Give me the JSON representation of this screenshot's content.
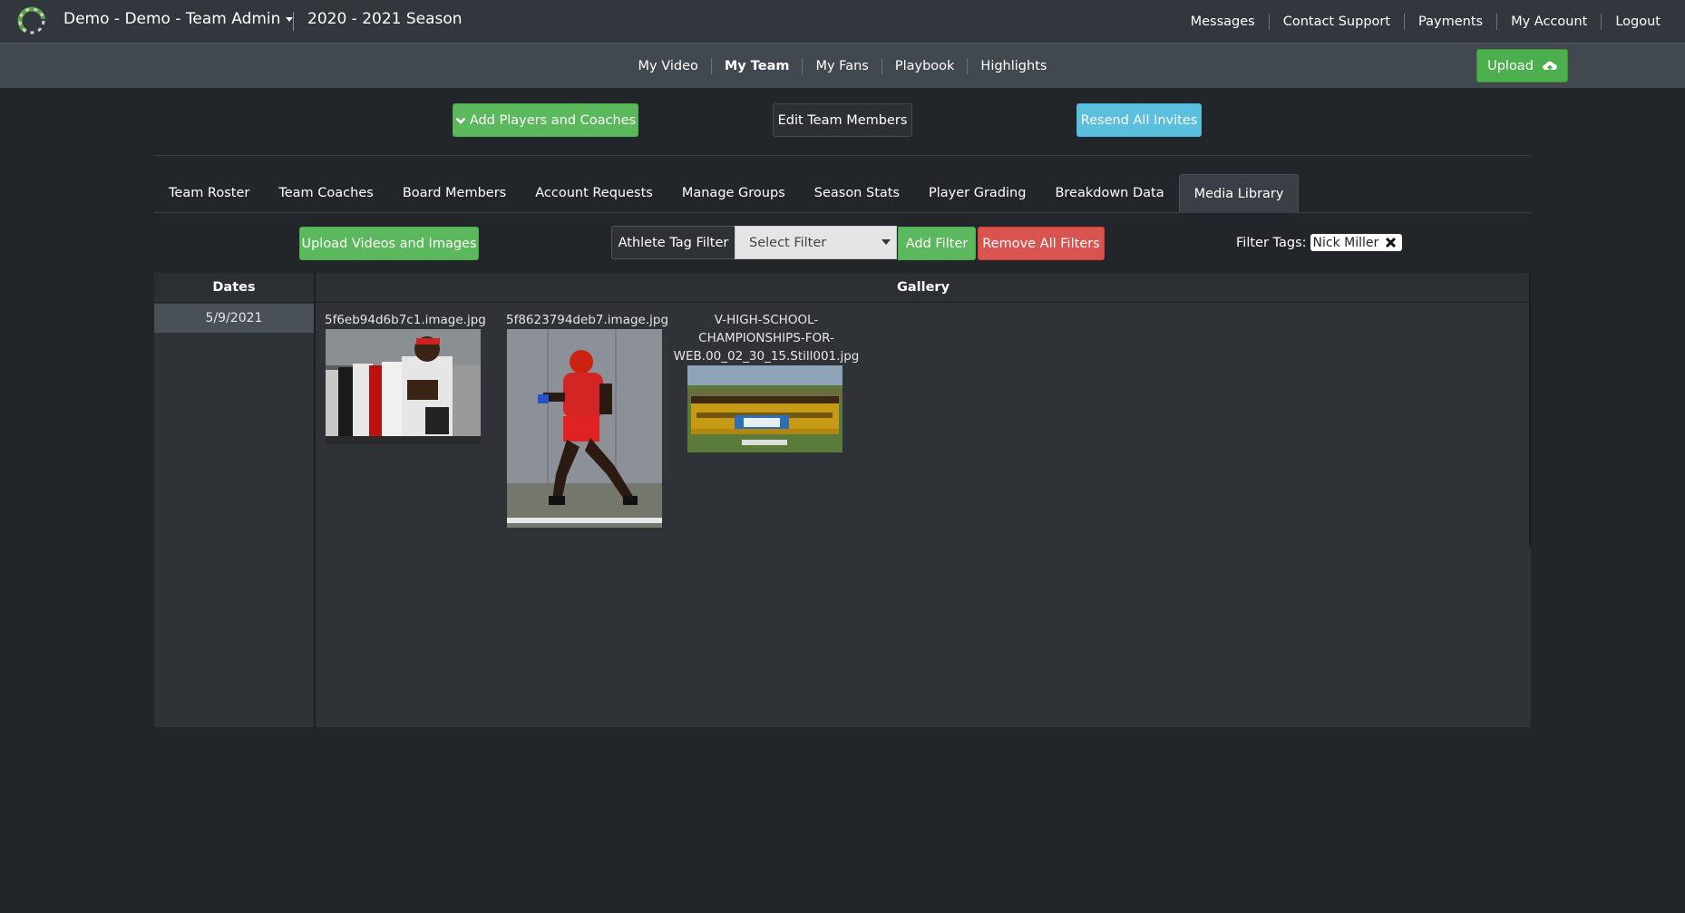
{
  "topbar": {
    "team_name": "Demo - Demo - Team Admin",
    "season": "2020 - 2021 Season",
    "links": [
      "Messages",
      "Contact Support",
      "Payments",
      "My Account",
      "Logout"
    ]
  },
  "subnav": {
    "links": [
      "My Video",
      "My Team",
      "My Fans",
      "Playbook",
      "Highlights"
    ],
    "active": "My Team",
    "upload_label": "Upload"
  },
  "actions": {
    "add_players": "Add Players and Coaches",
    "edit_members": "Edit Team Members",
    "resend_invites": "Resend All Invites"
  },
  "tabs": [
    "Team Roster",
    "Team Coaches",
    "Board Members",
    "Account Requests",
    "Manage Groups",
    "Season Stats",
    "Player Grading",
    "Breakdown Data",
    "Media Library"
  ],
  "active_tab": "Media Library",
  "filters": {
    "upload_media": "Upload Videos and Images",
    "athlete_tag_filter": "Athlete Tag Filter",
    "select_placeholder": "Select Filter",
    "add_filter": "Add Filter",
    "remove_all": "Remove All Filters",
    "filter_tags_label": "Filter Tags:",
    "tags": [
      "Nick Miller"
    ]
  },
  "media": {
    "dates_header": "Dates",
    "gallery_header": "Gallery",
    "dates": [
      "5/9/2021"
    ],
    "items": [
      {
        "name": "5f6eb94d6b7c1.image.jpg"
      },
      {
        "name": "5f8623794deb7.image.jpg"
      },
      {
        "name_lines": [
          "V-HIGH-SCHOOL-",
          "CHAMPIONSHIPS-FOR-",
          "WEB.00_02_30_15.Still001.jpg"
        ]
      }
    ]
  },
  "colors": {
    "green": "#5cb85c",
    "blue": "#5bc0de",
    "red": "#d9534f",
    "background": "#22262b"
  }
}
